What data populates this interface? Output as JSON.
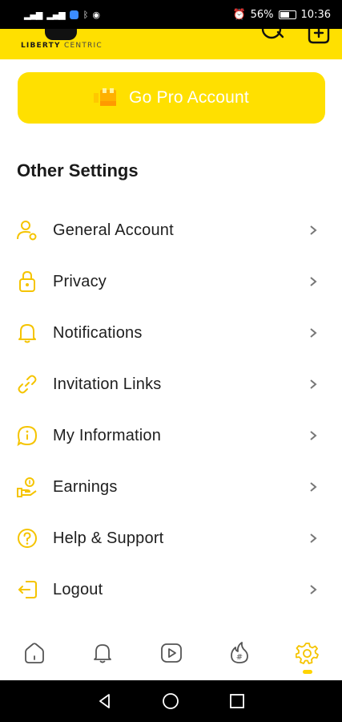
{
  "status_bar": {
    "battery": "56%",
    "time": "10:36"
  },
  "header": {
    "logo_primary": "LIBERTY",
    "logo_secondary": "CENTRIC",
    "accent": "#ffe000"
  },
  "pro_button": {
    "label": "Go Pro Account"
  },
  "section_title": "Other Settings",
  "menu": [
    {
      "label": "General Account",
      "icon": "user-gear-icon"
    },
    {
      "label": "Privacy",
      "icon": "lock-icon"
    },
    {
      "label": "Notifications",
      "icon": "bell-icon"
    },
    {
      "label": "Invitation Links",
      "icon": "link-icon"
    },
    {
      "label": "My Information",
      "icon": "info-bubble-icon"
    },
    {
      "label": "Earnings",
      "icon": "coin-hand-icon"
    },
    {
      "label": "Help & Support",
      "icon": "help-icon"
    },
    {
      "label": "Logout",
      "icon": "logout-icon"
    }
  ],
  "bottom_nav": [
    {
      "name": "home",
      "icon": "home-icon"
    },
    {
      "name": "notifications",
      "icon": "bell-icon"
    },
    {
      "name": "videos",
      "icon": "play-icon"
    },
    {
      "name": "trending",
      "icon": "hashtag-flame-icon"
    },
    {
      "name": "settings",
      "icon": "gear-icon",
      "active": true
    }
  ],
  "colors": {
    "accent": "#ffe000",
    "icon": "#f5c400",
    "text": "#1e1e1e"
  }
}
